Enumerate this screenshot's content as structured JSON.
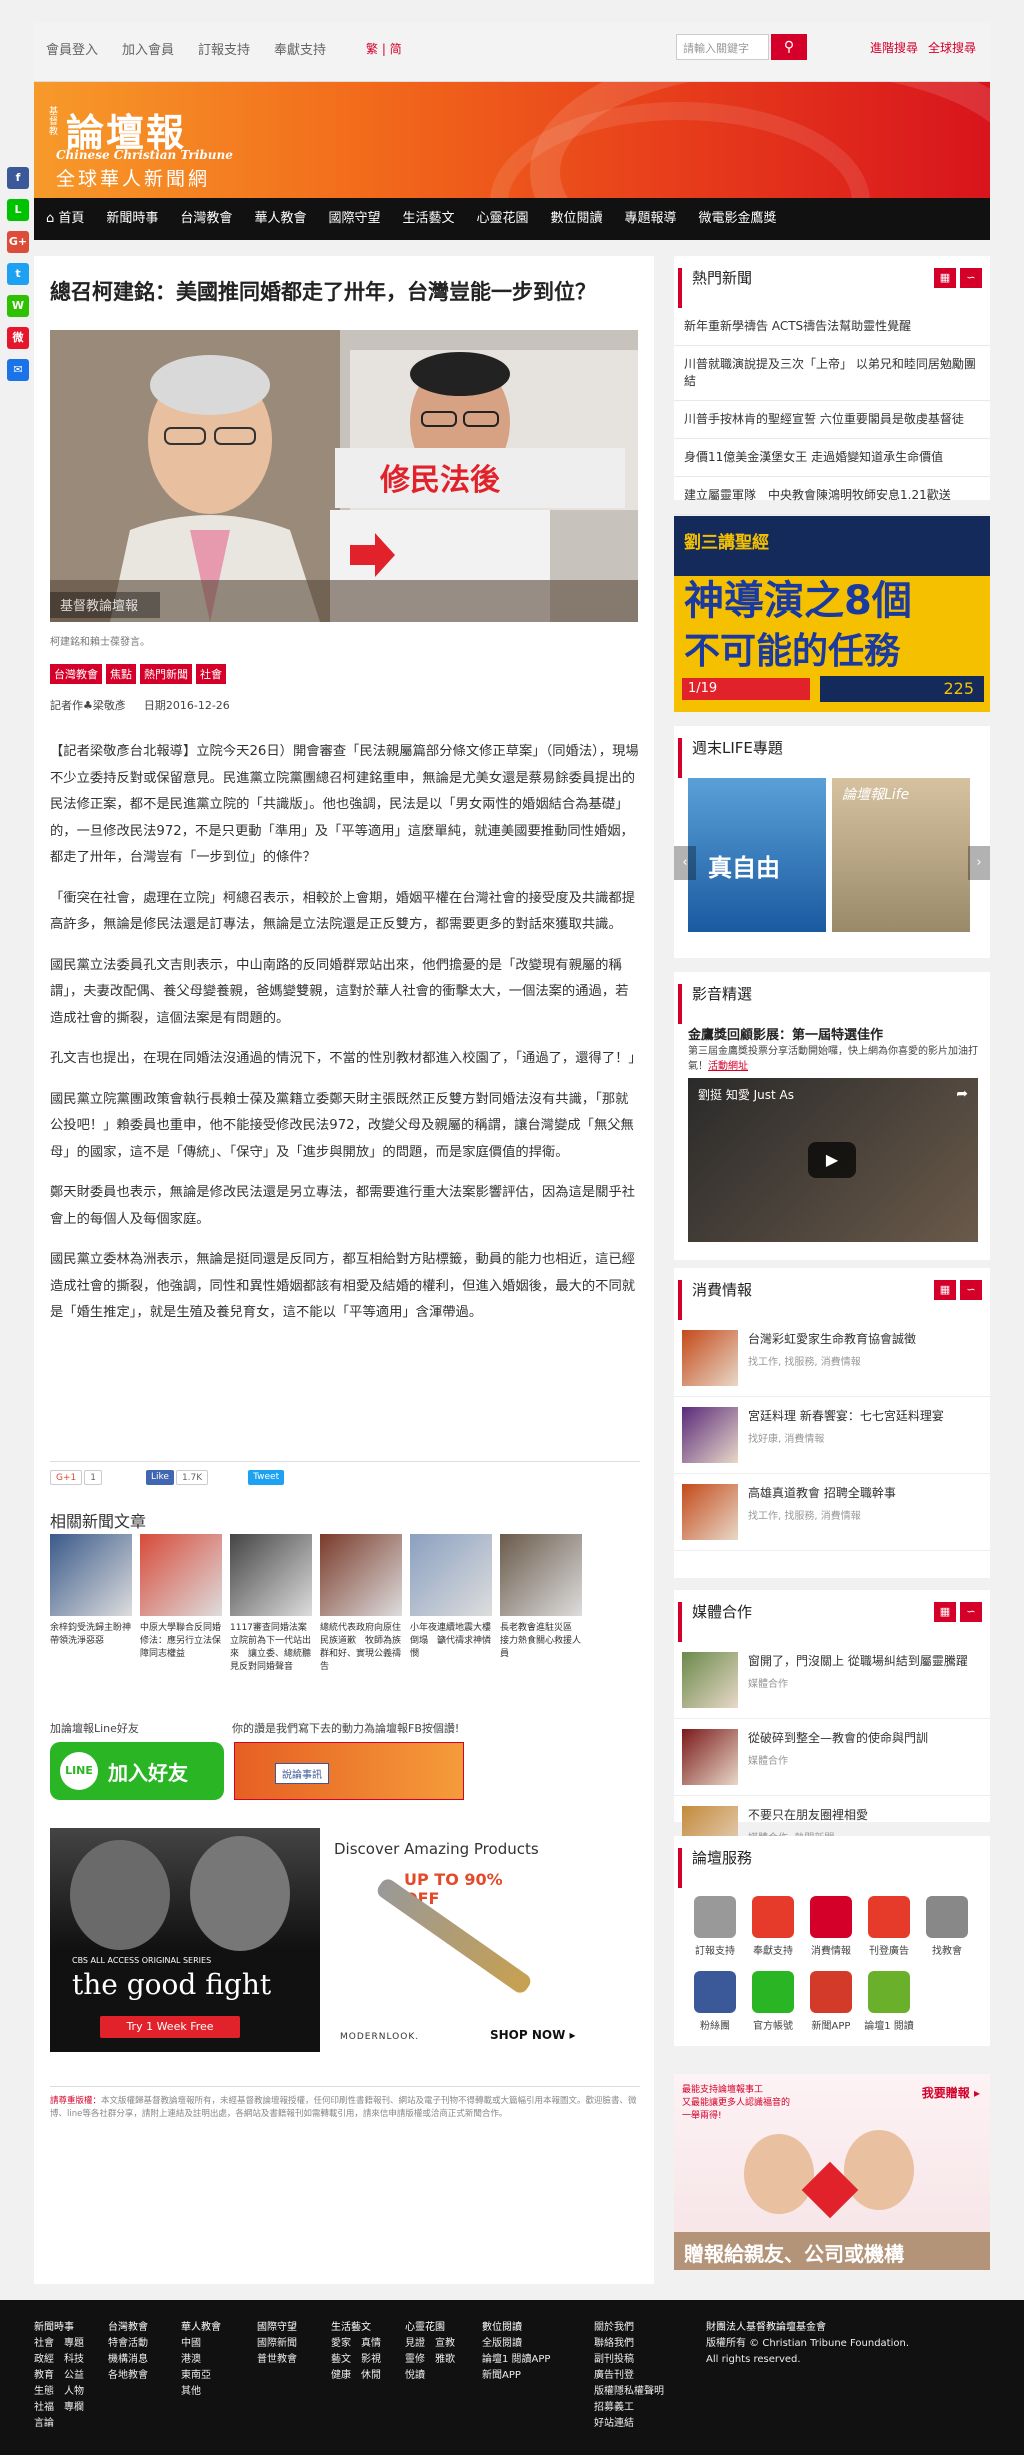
{
  "topbar": {
    "links": [
      "會員登入",
      "加入會員",
      "訂報支持",
      "奉獻支持"
    ],
    "lang": "繁 | 简",
    "search_placeholder": "請輸入關鍵字",
    "advanced": "進階搜尋",
    "global": "全球搜尋"
  },
  "logo": {
    "small": "基督教",
    "main": "論壇報",
    "en": "Chinese Christian Tribune",
    "cn": "全球華人新聞網"
  },
  "nav": [
    "首頁",
    "新聞時事",
    "台灣教會",
    "華人教會",
    "國際守望",
    "生活藝文",
    "心靈花園",
    "數位閱讀",
    "專題報導",
    "微電影金鷹獎"
  ],
  "social": [
    {
      "name": "facebook",
      "color": "#3b5998",
      "glyph": "f"
    },
    {
      "name": "line",
      "color": "#00c300",
      "glyph": "L"
    },
    {
      "name": "google-plus",
      "color": "#dd4b39",
      "glyph": "G+"
    },
    {
      "name": "twitter",
      "color": "#1da1f2",
      "glyph": "t"
    },
    {
      "name": "wechat",
      "color": "#2dc100",
      "glyph": "W"
    },
    {
      "name": "weibo",
      "color": "#e6162d",
      "glyph": "微"
    },
    {
      "name": "email",
      "color": "#1a73e8",
      "glyph": "✉"
    }
  ],
  "article": {
    "title": "總召柯建銘：美國推同婚都走了卅年，台灣豈能一步到位？",
    "photo_sign": "修民法後",
    "photo_watermark": "基督教論壇報",
    "caption": "柯建銘和賴士葆發言。",
    "tags": [
      "台灣教會",
      "焦點",
      "熱門新聞",
      "社會"
    ],
    "author": "記者作♣梁敬彥",
    "date": "日期2016-12-26",
    "paragraphs": [
      "【記者梁敬彥台北報導】立院今天26日）開會審查「民法親屬篇部分條文修正草案」（同婚法），現場不少立委持反對或保留意見。民進黨立院黨團總召柯建銘重申，無論是尤美女還是蔡易餘委員提出的民法修正案，都不是民進黨立院的「共識版」。他也強調，民法是以「男女兩性的婚姻結合為基礎」的，一旦修改民法972，不是只更動「準用」及「平等適用」這麼單純，就連美國要推動同性婚姻，都走了卅年，台灣豈有「一步到位」的條件？",
      "「衝突在社會，處理在立院」柯總召表示，相較於上會期，婚姻平權在台灣社會的接受度及共識都提高許多，無論是修民法還是訂專法，無論是立法院還是正反雙方，都需要更多的對話來獲取共識。",
      "國民黨立法委員孔文吉則表示，中山南路的反同婚群眾站出來，他們擔憂的是「改變現有親屬的稱謂」，夫妻改配偶、養父母變養親，爸媽變雙親，這對於華人社會的衝擊太大，一個法案的通過，若造成社會的撕裂，這個法案是有問題的。",
      "孔文吉也提出，在現在同婚法沒通過的情況下，不當的性別教材都進入校園了，「通過了，還得了！」",
      "國民黨立院黨團政策會執行長賴士葆及黨籍立委鄭天財主張既然正反雙方對同婚法沒有共識，「那就公投吧！」賴委員也重申，他不能接受修改民法972，改變父母及親屬的稱謂，讓台灣變成「無父無母」的國家，這不是「傳統」、「保守」及「進步與開放」的問題，而是家庭價值的捍衛。",
      "鄭天財委員也表示，無論是修改民法還是另立專法，都需要進行重大法案影響評估，因為這是關乎社會上的每個人及每個家庭。",
      "國民黨立委林為洲表示，無論是挺同還是反同方，都互相給對方貼標籤，動員的能力也相近，這已經造成社會的撕裂，他強調，同性和異性婚姻都該有相愛及結婚的權利，但進入婚姻後，最大的不同就是「婚生推定」，就是生殖及養兒育女，這不能以「平等適用」含渾帶過。"
    ]
  },
  "share": {
    "gplus": "G+1",
    "gplus_count": "1",
    "fb": "Like",
    "fb_count": "1.7K",
    "tweet": "Tweet"
  },
  "related": {
    "title": "相關新聞文章",
    "items": [
      {
        "text": "余梓鈞受洗歸主盼神帶領洗淨惡惡",
        "color": "#3a5a8a"
      },
      {
        "text": "中原大學聯合反同婚修法：應另行立法保障同志權益",
        "color": "#d84a3a"
      },
      {
        "text": "1117審查同婚法案　立院前為下一代站出來　讓立委、總統聽見反對同婚聲音",
        "color": "#444444"
      },
      {
        "text": "總統代表政府向原住民族道歉　牧師為族群和好、實現公義禱告",
        "color": "#7a3a2a"
      },
      {
        "text": "小年夜連續地震大樓倒塌　籲代禱求神憐憫",
        "color": "#8aa0c0"
      },
      {
        "text": "長老教會進駐災區　接力熱食關心救援人員",
        "color": "#6a5a4a"
      }
    ]
  },
  "line": {
    "label": "加論壇報Line好友",
    "button": "加入好友",
    "logo": "LINE"
  },
  "fb_box": {
    "label": "你的讚是我們寫下去的動力為論壇報FB按個讚!",
    "text": "說論事訊"
  },
  "ad": {
    "left_brand": "CBS ALL ACCESS ORIGINAL SERIES",
    "left_title": "the good fight",
    "left_btn": "Try 1 Week Free",
    "right_title": "Discover Amazing Products",
    "right_pct": "UP TO 90% OFF",
    "right_brand": "MODERNLOOK.",
    "right_shop": "SHOP NOW ▸"
  },
  "notice": {
    "label": "請尊重版權：",
    "text": "本文版權歸基督教論壇報所有，未經基督教論壇報授權，任何印刷性書籍報刊、網站及電子刊物不得轉載或大篇幅引用本報圖文。歡迎臉書、微博、line等各社群分享，請附上連結及註明出處，各網站及書籍報刊如需轉載引用，請來信申請版權或洽商正式新聞合作。"
  },
  "sidebar": {
    "hot": {
      "title": "熱門新聞",
      "items": [
        "新年重新學禱告 ACTS禱告法幫助靈性覺醒",
        "川普就職演說提及三次「上帝」 以弟兄和睦同居勉勵團結",
        "川普手按林肯的聖經宣誓 六位重要閣員是敬虔基督徒",
        "身價11億美金漢堡女王 走過婚變知道承生命價值",
        "建立屬靈軍隊　中央教會陳鴻明牧師安息1.21歡送"
      ]
    },
    "promo": {
      "head": "劉三講聖經",
      "big": "神導演之8個",
      "sub": "不可能的任務",
      "date": "1/19",
      "price": "225"
    },
    "life": {
      "title": "週末LIFE專題",
      "cover_a": "真自由",
      "cover_b": "論壇報Life"
    },
    "video": {
      "title": "影音精選",
      "headline": "金鷹獎回顧影展：第一屆特選佳作",
      "desc": "第三屆金鷹獎投票分享活動開始囉，快上網為你喜愛的影片加油打氣！",
      "link": "活動網址",
      "clip": "劉挺 知愛 Just As"
    },
    "consumer": {
      "title": "消費情報",
      "items": [
        {
          "t": "台灣彩虹愛家生命教育協會誠徵",
          "s": "找工作, 找服務, 消費情報",
          "c": "#c44a1a"
        },
        {
          "t": "宮廷料理 新春饗宴：七七宮廷料理宴",
          "s": "找好康, 消費情報",
          "c": "#5a2a7a"
        },
        {
          "t": "高雄真道教會 招聘全職幹事",
          "s": "找工作, 找服務, 消費情報",
          "c": "#c44a1a"
        }
      ]
    },
    "media": {
      "title": "媒體合作",
      "items": [
        {
          "t": "窗開了，門沒關上 從職場糾結到屬靈騰躍",
          "s": "媒體合作",
          "c": "#6a8a4a"
        },
        {
          "t": "從破碎到整全—教會的使命與門訓",
          "s": "媒體合作",
          "c": "#7a1a1a"
        },
        {
          "t": "不要只在朋友圈裡相愛",
          "s": "媒體合作, 熱門新聞",
          "c": "#c48a3a"
        }
      ]
    },
    "service": {
      "title": "論壇服務",
      "items": [
        {
          "l": "訂報支持",
          "c": "#999999"
        },
        {
          "l": "奉獻支持",
          "c": "#e63a2a"
        },
        {
          "l": "消費情報",
          "c": "#d4002a"
        },
        {
          "l": "刊登廣告",
          "c": "#e63a2a"
        },
        {
          "l": "找教會",
          "c": "#888888"
        },
        {
          "l": "粉絲團",
          "c": "#3b5998"
        },
        {
          "l": "官方帳號",
          "c": "#29b524"
        },
        {
          "l": "新聞APP",
          "c": "#d43a2a"
        },
        {
          "l": "論壇1 閱讀",
          "c": "#6ab02a"
        }
      ]
    },
    "donate": {
      "top": "我要贈報 ▸",
      "line1": "最能支持論壇報事工",
      "line2": "又最能讓更多人認識福音的",
      "line3": "一舉兩得!",
      "bottom": "贈報給親友、公司或機構"
    }
  },
  "footer": {
    "cols": [
      {
        "h": "新聞時事",
        "items": [
          "社會　專題",
          "政經　科技",
          "教育　公益",
          "生態　人物",
          "社福　專欄",
          "言論"
        ]
      },
      {
        "h": "台灣教會",
        "items": [
          "特會活動",
          "機構消息",
          "各地教會"
        ]
      },
      {
        "h": "華人教會",
        "items": [
          "中國",
          "港澳",
          "東南亞",
          "其他"
        ]
      },
      {
        "h": "國際守望",
        "items": [
          "國際新聞",
          "普世教會"
        ]
      },
      {
        "h": "生活藝文",
        "items": [
          "愛家　真情",
          "藝文　影視",
          "健康　休閒"
        ]
      },
      {
        "h": "心靈花園",
        "items": [
          "見證　宣教",
          "靈修　雅歌",
          "悅讀"
        ]
      },
      {
        "h": "數位閱讀",
        "items": [
          "全版閱讀",
          "論壇1 閱讀APP",
          "新聞APP"
        ]
      },
      {
        "h": "",
        "items": [
          "關於我們",
          "聯絡我們",
          "副刊投稿",
          "廣告刊登",
          "版權隱私權聲明",
          "招募義工",
          "好站連結"
        ]
      },
      {
        "h": "財團法人基督教論壇基金會",
        "items": [
          "版權所有 © Christian Tribune Foundation.",
          "All rights reserved."
        ]
      }
    ]
  }
}
